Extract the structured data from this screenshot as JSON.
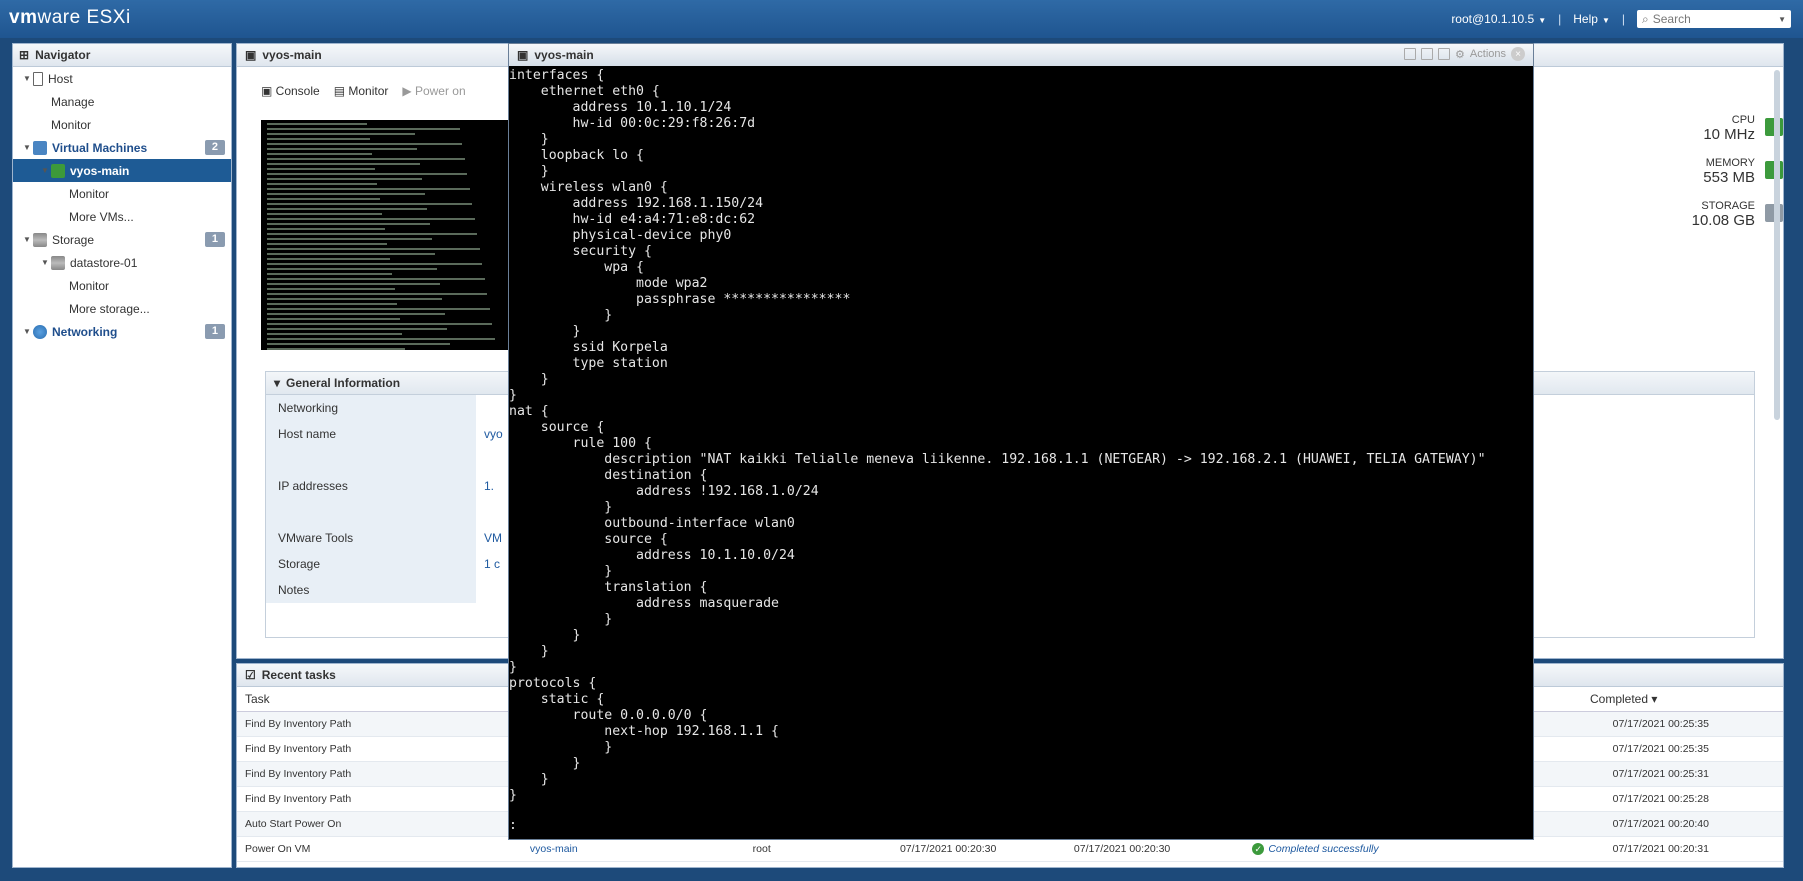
{
  "topbar": {
    "logo_vm": "vm",
    "logo_ware": "ware",
    "logo_esxi": "ESXi",
    "user": "root@10.1.10.5",
    "help": "Help",
    "search_placeholder": "Search"
  },
  "navigator": {
    "title": "Navigator",
    "items": [
      {
        "label": "Host",
        "level": 0,
        "kind": "host"
      },
      {
        "label": "Manage",
        "level": 1
      },
      {
        "label": "Monitor",
        "level": 1
      },
      {
        "label": "Virtual Machines",
        "level": 0,
        "kind": "section",
        "badge": "2"
      },
      {
        "label": "vyos-main",
        "level": 1,
        "selected": true
      },
      {
        "label": "Monitor",
        "level": 2
      },
      {
        "label": "More VMs...",
        "level": 2
      },
      {
        "label": "Storage",
        "level": 0,
        "kind": "storage",
        "badge": "1"
      },
      {
        "label": "datastore-01",
        "level": 1
      },
      {
        "label": "Monitor",
        "level": 2
      },
      {
        "label": "More storage...",
        "level": 2
      },
      {
        "label": "Networking",
        "level": 0,
        "kind": "section",
        "badge": "1"
      }
    ]
  },
  "vm_panel": {
    "title": "vyos-main",
    "toolbar": {
      "console": "Console",
      "monitor": "Monitor",
      "power_on": "Power on"
    },
    "resources": [
      {
        "label": "CPU",
        "value": "10 MHz",
        "color": "#3c9a3c"
      },
      {
        "label": "MEMORY",
        "value": "553 MB",
        "color": "#3c9a3c"
      },
      {
        "label": "STORAGE",
        "value": "10.08 GB",
        "color": "#8f9aa5"
      }
    ],
    "general_info": {
      "title": "General Information",
      "rows": [
        {
          "key": "Networking",
          "value": ""
        },
        {
          "key": "Host name",
          "value": "vyo"
        },
        {
          "key": "IP addresses",
          "value": "1."
        },
        {
          "key": "VMware Tools",
          "value": "VM"
        },
        {
          "key": "Storage",
          "value": "1 c"
        },
        {
          "key": "Notes",
          "value": ""
        }
      ]
    }
  },
  "recent_tasks": {
    "title": "Recent tasks",
    "columns": {
      "task": "Task",
      "completed": "Completed ▾"
    },
    "rows": [
      {
        "task": "Find By Inventory Path",
        "target": "",
        "initiator": "",
        "queued": "",
        "started": "",
        "result": "",
        "completed": "07/17/2021 00:25:35"
      },
      {
        "task": "Find By Inventory Path",
        "target": "",
        "initiator": "",
        "queued": "",
        "started": "",
        "result": "",
        "completed": "07/17/2021 00:25:35"
      },
      {
        "task": "Find By Inventory Path",
        "target": "",
        "initiator": "",
        "queued": "",
        "started": "",
        "result": "",
        "completed": "07/17/2021 00:25:31"
      },
      {
        "task": "Find By Inventory Path",
        "target": "",
        "initiator": "",
        "queued": "",
        "started": "",
        "result": "",
        "completed": "07/17/2021 00:25:28"
      },
      {
        "task": "Auto Start Power On",
        "target": "",
        "initiator": "",
        "queued": "",
        "started": "",
        "result": "",
        "completed": "07/17/2021 00:20:40"
      },
      {
        "task": "Power On VM",
        "target": "vyos-main",
        "initiator": "root",
        "queued": "07/17/2021 00:20:30",
        "started": "07/17/2021 00:20:30",
        "result": "Completed successfully",
        "completed": "07/17/2021 00:20:31"
      }
    ]
  },
  "console": {
    "title": "vyos-main",
    "actions": "Actions",
    "lines": [
      "interfaces {",
      "    ethernet eth0 {",
      "        address 10.1.10.1/24",
      "        hw-id 00:0c:29:f8:26:7d",
      "    }",
      "    loopback lo {",
      "    }",
      "    wireless wlan0 {",
      "        address 192.168.1.150/24",
      "        hw-id e4:a4:71:e8:dc:62",
      "        physical-device phy0",
      "        security {",
      "            wpa {",
      "                mode wpa2",
      "                passphrase ****************",
      "            }",
      "        }",
      "        ssid Korpela",
      "        type station",
      "    }",
      "}",
      "nat {",
      "    source {",
      "        rule 100 {",
      "            description \"NAT kaikki Telialle meneva liikenne. 192.168.1.1 (NETGEAR) -> 192.168.2.1 (HUAWEI, TELIA GATEWAY)\"",
      "            destination {",
      "                address !192.168.1.0/24",
      "            }",
      "            outbound-interface wlan0",
      "            source {",
      "                address 10.1.10.0/24",
      "            }",
      "            translation {",
      "                address masquerade",
      "            }",
      "        }",
      "    }",
      "}",
      "protocols {",
      "    static {",
      "        route 0.0.0.0/0 {",
      "            next-hop 192.168.1.1 {",
      "            }",
      "        }",
      "    }",
      "}",
      "",
      ":"
    ]
  }
}
